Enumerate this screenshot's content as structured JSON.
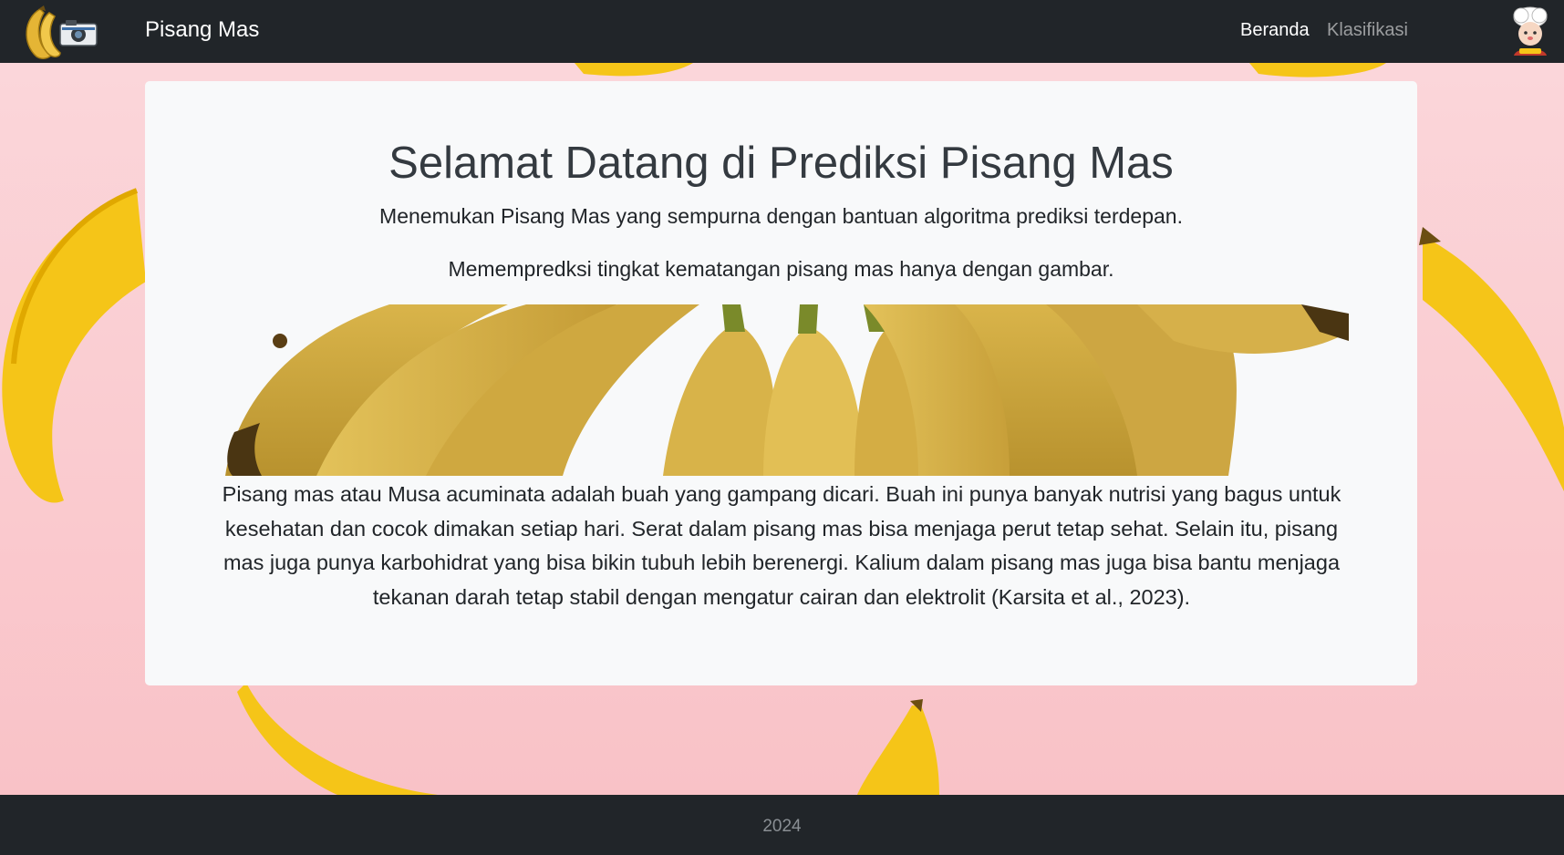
{
  "navbar": {
    "brand": "Pisang Mas",
    "links": [
      "Beranda",
      "Klasifikasi"
    ]
  },
  "main": {
    "title": "Selamat Datang di Prediksi Pisang Mas",
    "subtitle": "Menemukan Pisang Mas yang sempurna dengan bantuan algoritma prediksi terdepan.",
    "subtitle2": "Memempredksi tingkat kematangan pisang mas hanya dengan gambar.",
    "description": "Pisang mas atau Musa acuminata adalah buah yang gampang dicari. Buah ini punya banyak nutrisi yang bagus untuk kesehatan dan cocok dimakan setiap hari. Serat dalam pisang mas bisa menjaga perut tetap sehat. Selain itu, pisang mas juga punya karbohidrat yang bisa bikin tubuh lebih berenergi. Kalium dalam pisang mas juga bisa bantu menjaga tekanan darah tetap stabil dengan mengatur cairan dan elektrolit (Karsita et al., 2023)."
  },
  "footer": {
    "text": "2024"
  },
  "colors": {
    "navbar_bg": "#212529",
    "background": "#f9c6cb",
    "card_bg": "#f8f9fa",
    "banana_yellow": "#f5c518"
  },
  "icons": {
    "logo": "banana-camera-logo",
    "avatar": "chef-avatar-icon"
  }
}
